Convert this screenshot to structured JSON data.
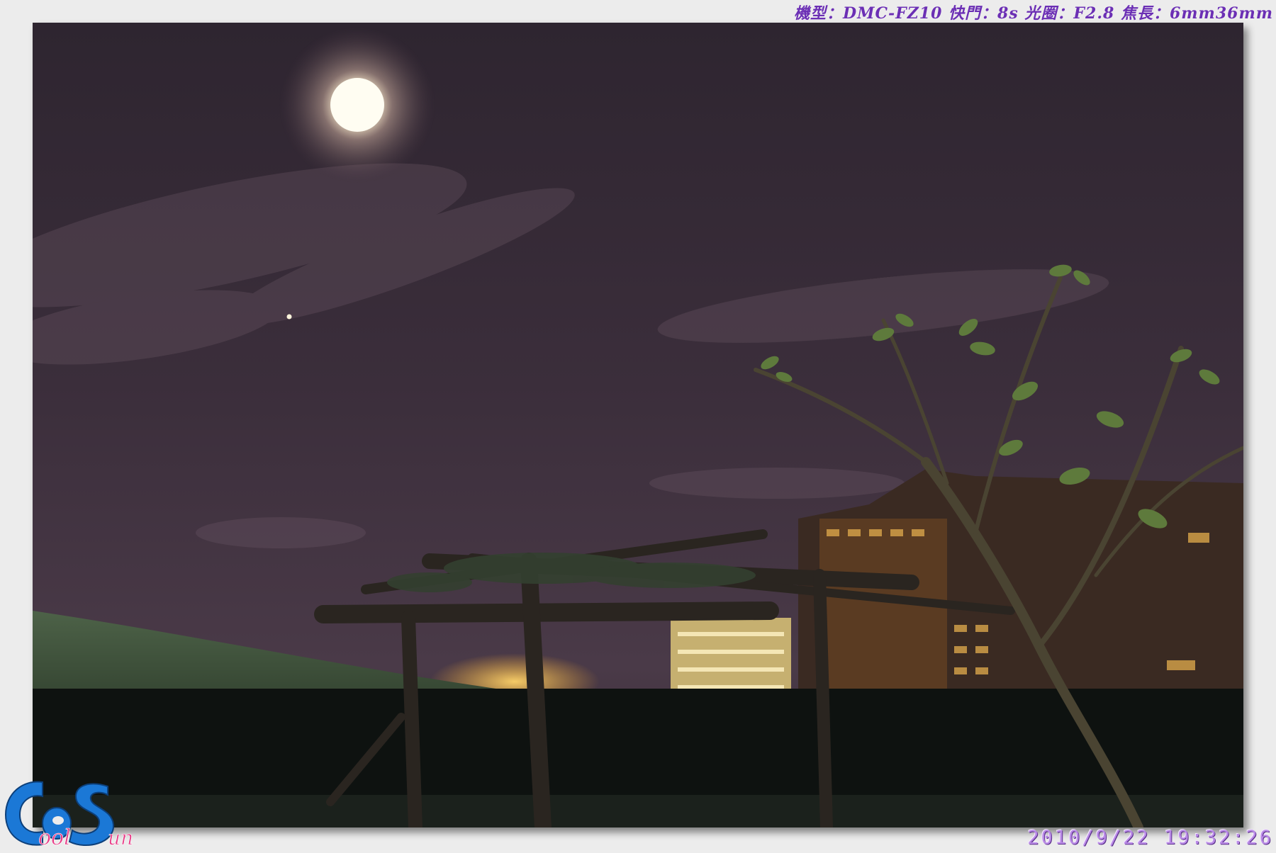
{
  "exif": {
    "text": "機型：DMC-FZ10 快門：8s 光圈：F2.8 焦長：6mm36mm"
  },
  "timestamp": {
    "text": "2010/9/22  19:32:26"
  },
  "logo": {
    "text": "CeeSun",
    "color_primary": "#1b78d6",
    "color_secondary": "#e83a86"
  },
  "photo": {
    "description_icon": "night-sky-moon-photo"
  }
}
